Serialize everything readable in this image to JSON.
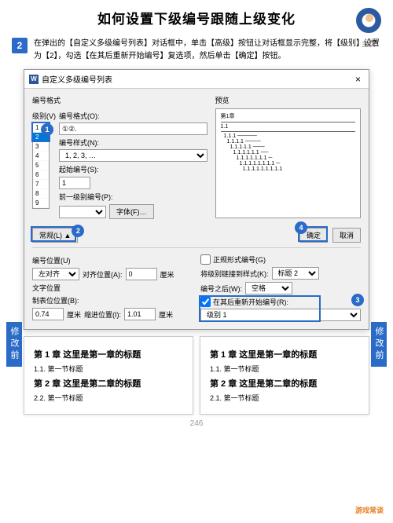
{
  "header": {
    "title": "如何设置下级编号跟随上级变化",
    "home": "主页"
  },
  "step": {
    "num": "2",
    "text": "在弹出的【自定义多级编号列表】对话框中，单击【高级】按钮让对话框显示完整，将【级别】设置为【2】，勾选【在其后重新开始编号】复选项，然后单击【确定】按钮。"
  },
  "dialog": {
    "title": "自定义多级编号列表",
    "close": "×",
    "numFormat": "编号格式",
    "preview": "预览",
    "levelLabel": "级别(V)",
    "levels": [
      "1",
      "2",
      "3",
      "4",
      "5",
      "6",
      "7",
      "8",
      "9"
    ],
    "selectedLevel": "2",
    "formatLabel": "编号格式(O):",
    "formatValue": "①②.",
    "styleLabel": "编号样式(N):",
    "styleValue": "1, 2, 3, …",
    "startLabel": "起始编号(S):",
    "startValue": "1",
    "prevLabel": "前一级别编号(P):",
    "prevValue": "",
    "fontBtn": "字体(F)…",
    "modeBtn": "常规(L)",
    "okBtn": "确定",
    "cancelBtn": "取消",
    "posLabel": "编号位置(U)",
    "alignValue": "左对齐",
    "alignAtLabel": "对齐位置(A):",
    "alignAtValue": "0",
    "unit": "厘米",
    "textPosLabel": "文字位置",
    "tabLabel": "制表位位置(B):",
    "tabValue": "0.74",
    "indentLabel": "缩进位置(I):",
    "indentValue": "1.01",
    "formalCheck": "正规形式编号(G)",
    "linkStyleLabel": "将级别链接到样式(K):",
    "linkStyleValue": "标题 2",
    "afterLabel": "编号之后(W):",
    "afterValue": "空格",
    "restartCheck": "在其后重新开始编号(R):",
    "restartValue": "级别 1",
    "previewTitle": "第1章",
    "previewSub": "1.1"
  },
  "callouts": {
    "c1": "1",
    "c2": "2",
    "c3": "3",
    "c4": "4"
  },
  "sides": {
    "left": "修改前",
    "right": "修改前"
  },
  "cards": {
    "a": {
      "h1": "第 1 章  这里是第一章的标题",
      "p1": "1.1.  第一节标题",
      "h2": "第 2 章  这里是第二章的标题",
      "p2": "2.2.  第一节标题"
    },
    "b": {
      "h1": "第 1 章  这里是第一章的标题",
      "p1": "1.1.  第一节标题",
      "h2": "第 2 章  这里是第二章的标题",
      "p2": "2.1.  第一节标题"
    }
  },
  "pageNum": "246",
  "watermark": "游戏常谈"
}
